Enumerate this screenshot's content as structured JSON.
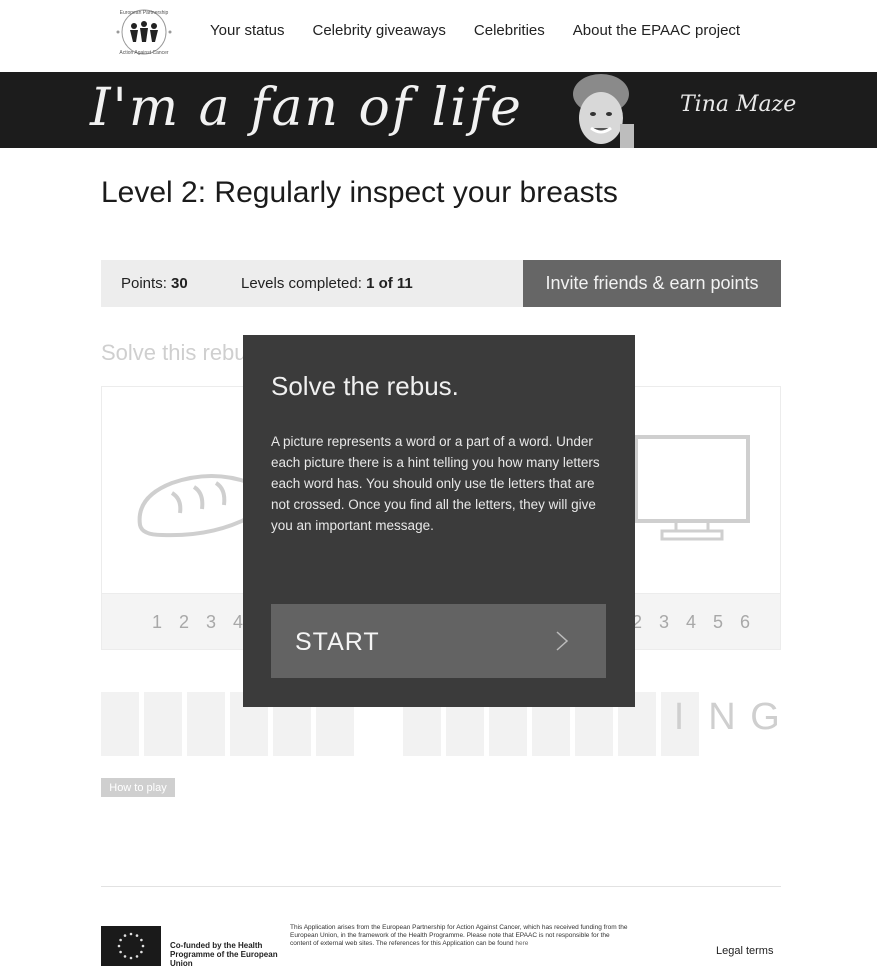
{
  "header": {
    "logo_text": "European Partnership Action Against Cancer",
    "nav": [
      "Your status",
      "Celebrity giveaways",
      "Celebrities",
      "About the EPAAC project"
    ]
  },
  "banner": {
    "script_text": "I'm a fan of life",
    "signature": "Tina Maze"
  },
  "page": {
    "title": "Level 2: Regularly inspect your breasts"
  },
  "status": {
    "points_label": "Points:",
    "points_value": "30",
    "levels_label": "Levels completed:",
    "levels_value": "1 of 11",
    "invite_label": "Invite friends & earn points"
  },
  "rebus": {
    "heading": "Solve this rebus",
    "numbers_left": "1 2 3 4",
    "numbers_right": "2 3 4 5 6",
    "answer_letters": [
      "I",
      "N",
      "G"
    ]
  },
  "modal": {
    "title": "Solve the rebus.",
    "text": "A picture represents a word or a part of a word. Under each picture there is a hint telling you how many letters each word has. You should only use tle letters that are not crossed. Once you find all the letters, they will give you an important message.",
    "start_label": "START"
  },
  "howto": {
    "label": "How to play"
  },
  "footer": {
    "cofunded": "Co-funded by the Health Programme of the European Union",
    "disclaimer": "This Application arises from the European Partnership for Action Against Cancer, which has received funding from the European Union, in the framework of the Health Programme. Please note that EPAAC is not responsible for the content of external web sites. The references for this Application can be found",
    "disclaimer_link": "here",
    "legal": "Legal terms"
  }
}
